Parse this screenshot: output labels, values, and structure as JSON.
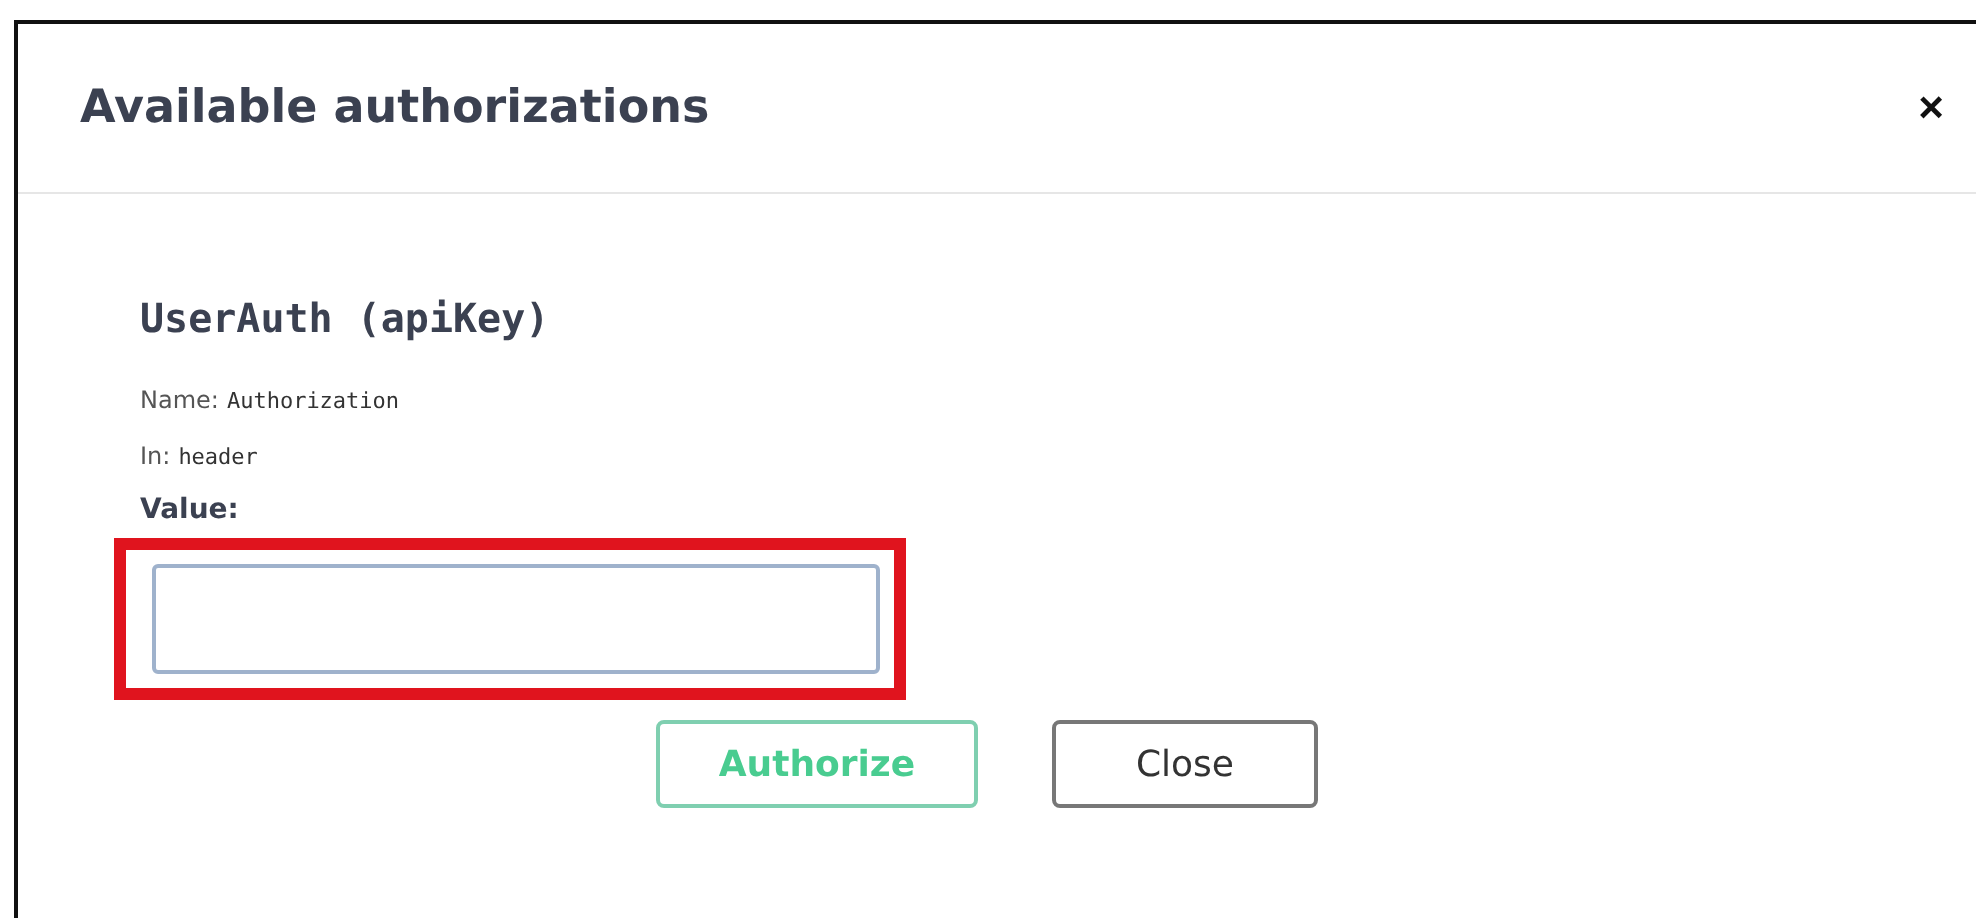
{
  "dialog": {
    "title": "Available authorizations",
    "close_icon": "×"
  },
  "scheme": {
    "name": "UserAuth",
    "type": "(apiKey)",
    "details": [
      {
        "label": "Name:",
        "value": "Authorization"
      },
      {
        "label": "In:",
        "value": "header"
      }
    ],
    "value_label": "Value:",
    "value_field": {
      "highlighted": true
    }
  },
  "buttons": [
    {
      "label": "Authorize",
      "kind": "primary"
    },
    {
      "label": "Close",
      "kind": "secondary"
    }
  ]
}
